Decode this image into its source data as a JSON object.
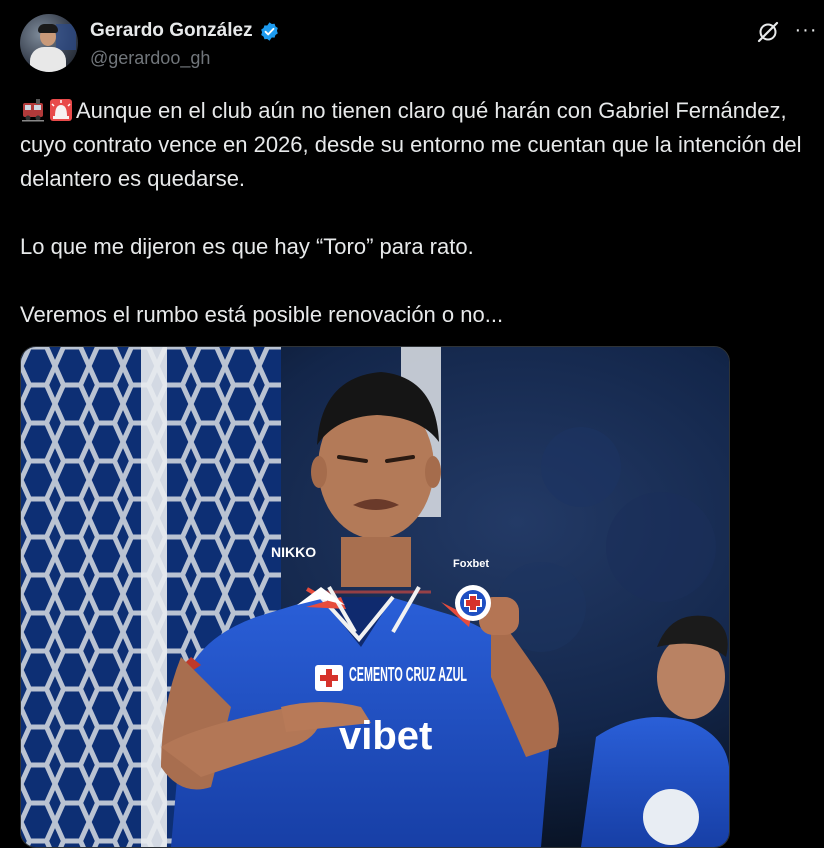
{
  "author": {
    "display_name": "Gerardo González",
    "handle": "@gerardoo_gh",
    "verified": true,
    "avatar_icon": "user-avatar"
  },
  "actions": {
    "grok_icon": "grok-icon",
    "more_icon": "more-options-icon",
    "more_glyph": "···"
  },
  "tweet": {
    "emojis": [
      "train-emoji",
      "siren-emoji"
    ],
    "paragraph1": "Aunque en el club aún no tienen claro qué harán con Gabriel Fernández, cuyo contrato vence en 2026, desde su entorno me cuentan que la intención del delantero es quedarse.",
    "paragraph2": "Lo que me dijeron es que hay “Toro” para rato.",
    "paragraph3": "Veremos el rumbo está posible renovación o no..."
  },
  "media": {
    "jersey_sponsor_top": "NIKKO",
    "jersey_brand": "Foxbet",
    "jersey_sponsor_main": "CEMENTO CRUZ AZUL",
    "jersey_sponsor_bottom": "vibet"
  },
  "colors": {
    "background": "#000000",
    "text_primary": "#e7e9ea",
    "text_secondary": "#71767b",
    "verified_blue": "#1d9bf0",
    "jersey_blue": "#1f4fc4"
  }
}
